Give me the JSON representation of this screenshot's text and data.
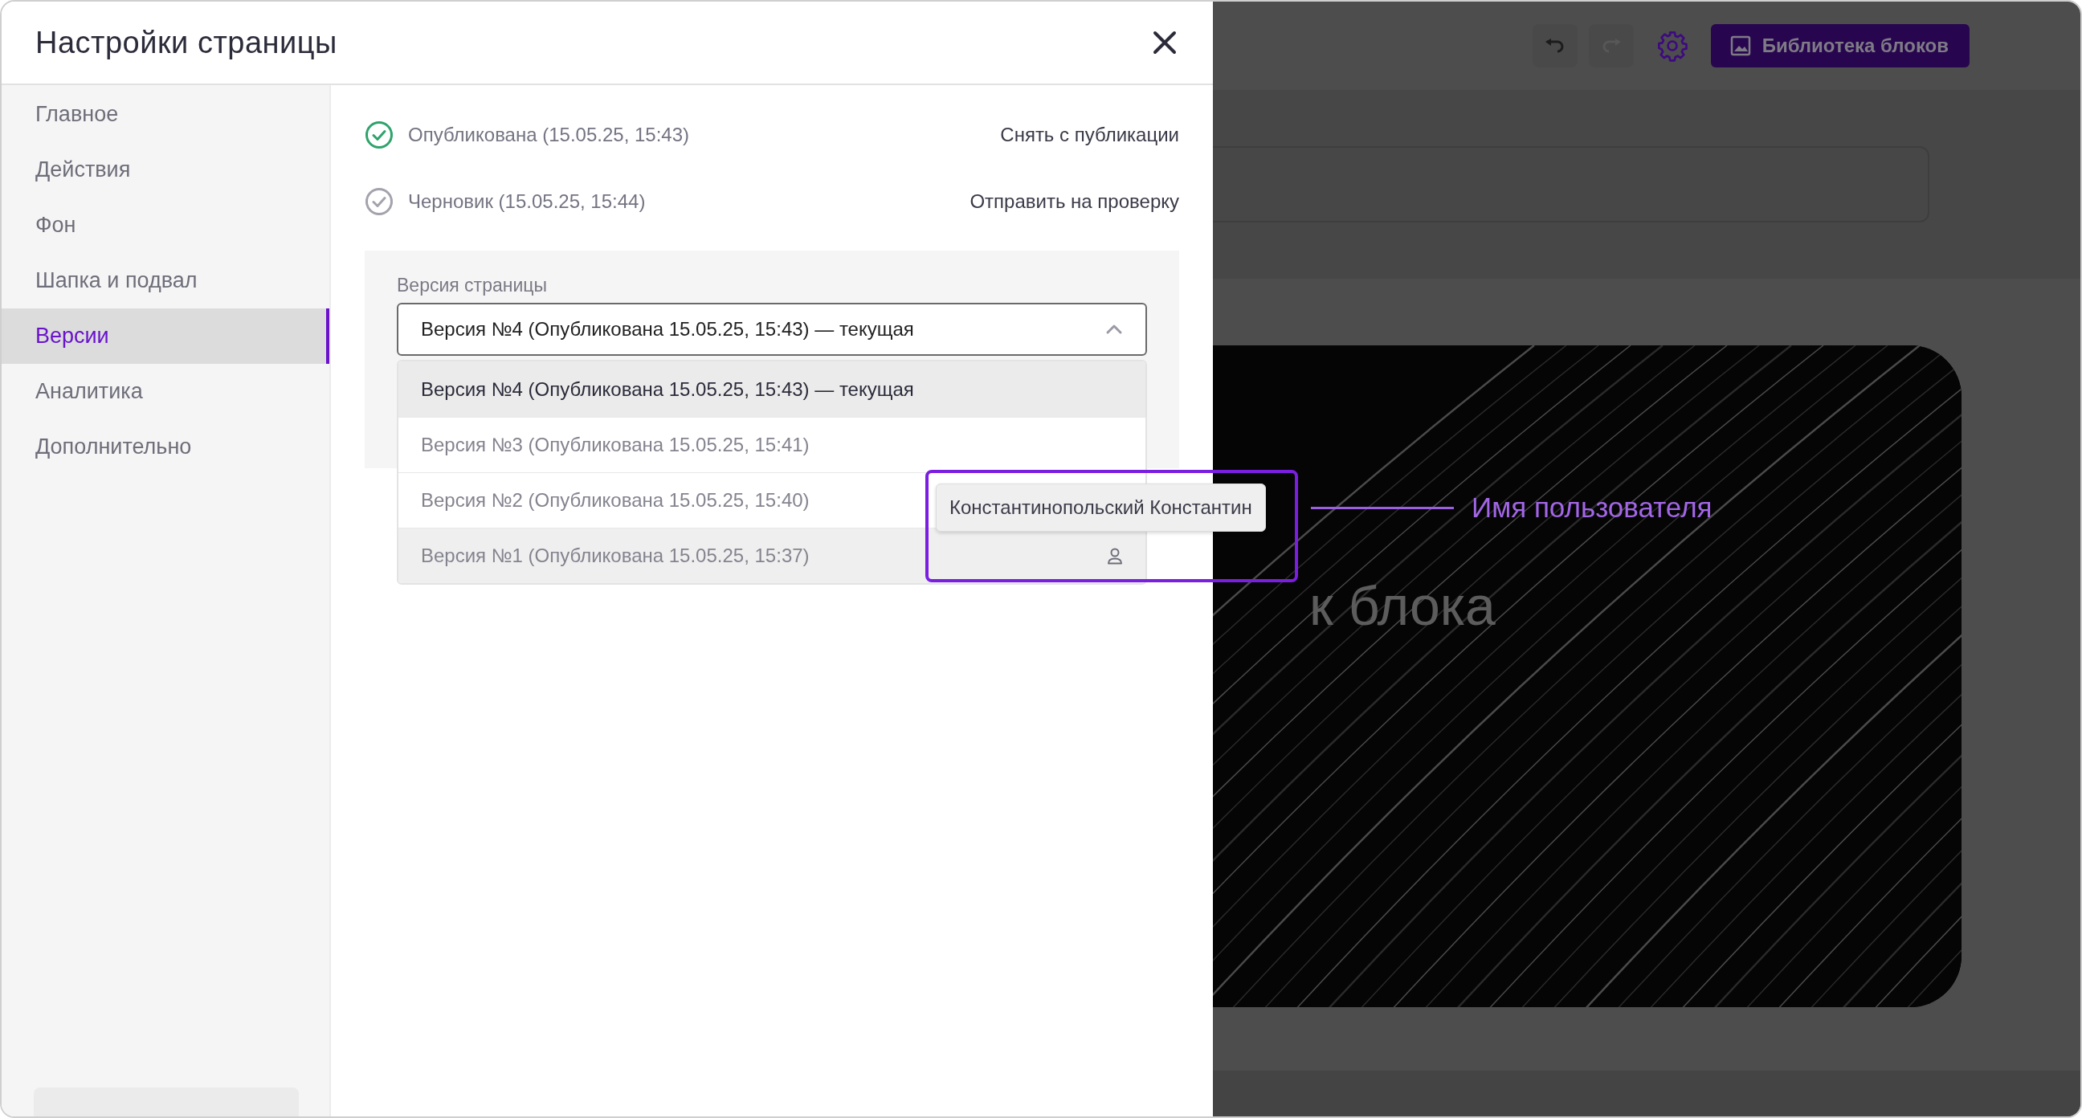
{
  "window": {
    "title": "Настройки страницы"
  },
  "sidebar": {
    "items": [
      {
        "label": "Главное",
        "selected": false
      },
      {
        "label": "Действия",
        "selected": false
      },
      {
        "label": "Фон",
        "selected": false
      },
      {
        "label": "Шапка и подвал",
        "selected": false
      },
      {
        "label": "Версии",
        "selected": true
      },
      {
        "label": "Аналитика",
        "selected": false
      },
      {
        "label": "Дополнительно",
        "selected": false
      }
    ]
  },
  "statuses": [
    {
      "kind": "published",
      "label": "Опубликована (15.05.25, 15:43)",
      "action": "Снять с публикации"
    },
    {
      "kind": "draft",
      "label": "Черновик (15.05.25, 15:44)",
      "action": "Отправить на проверку"
    }
  ],
  "version_select": {
    "label": "Версия страницы",
    "value": "Версия №4 (Опубликована 15.05.25, 15:43) — текущая",
    "expanded": true,
    "options": [
      {
        "label": "Версия №4 (Опубликована 15.05.25, 15:43) — текущая",
        "selected": true,
        "hovered": false
      },
      {
        "label": "Версия №3 (Опубликована 15.05.25, 15:41)",
        "selected": false,
        "hovered": false
      },
      {
        "label": "Версия №2 (Опубликована 15.05.25, 15:40)",
        "selected": false,
        "hovered": false
      },
      {
        "label": "Версия №1 (Опубликована 15.05.25, 15:37)",
        "selected": false,
        "hovered": true
      }
    ]
  },
  "tooltip": {
    "text": "Константинопольский Константин"
  },
  "annotation": {
    "text": "Имя пользователя"
  },
  "editor": {
    "undo": {
      "disabled": false
    },
    "redo": {
      "disabled": true
    },
    "library_button": "Библиотека блоков",
    "block_title": "к блока"
  }
}
